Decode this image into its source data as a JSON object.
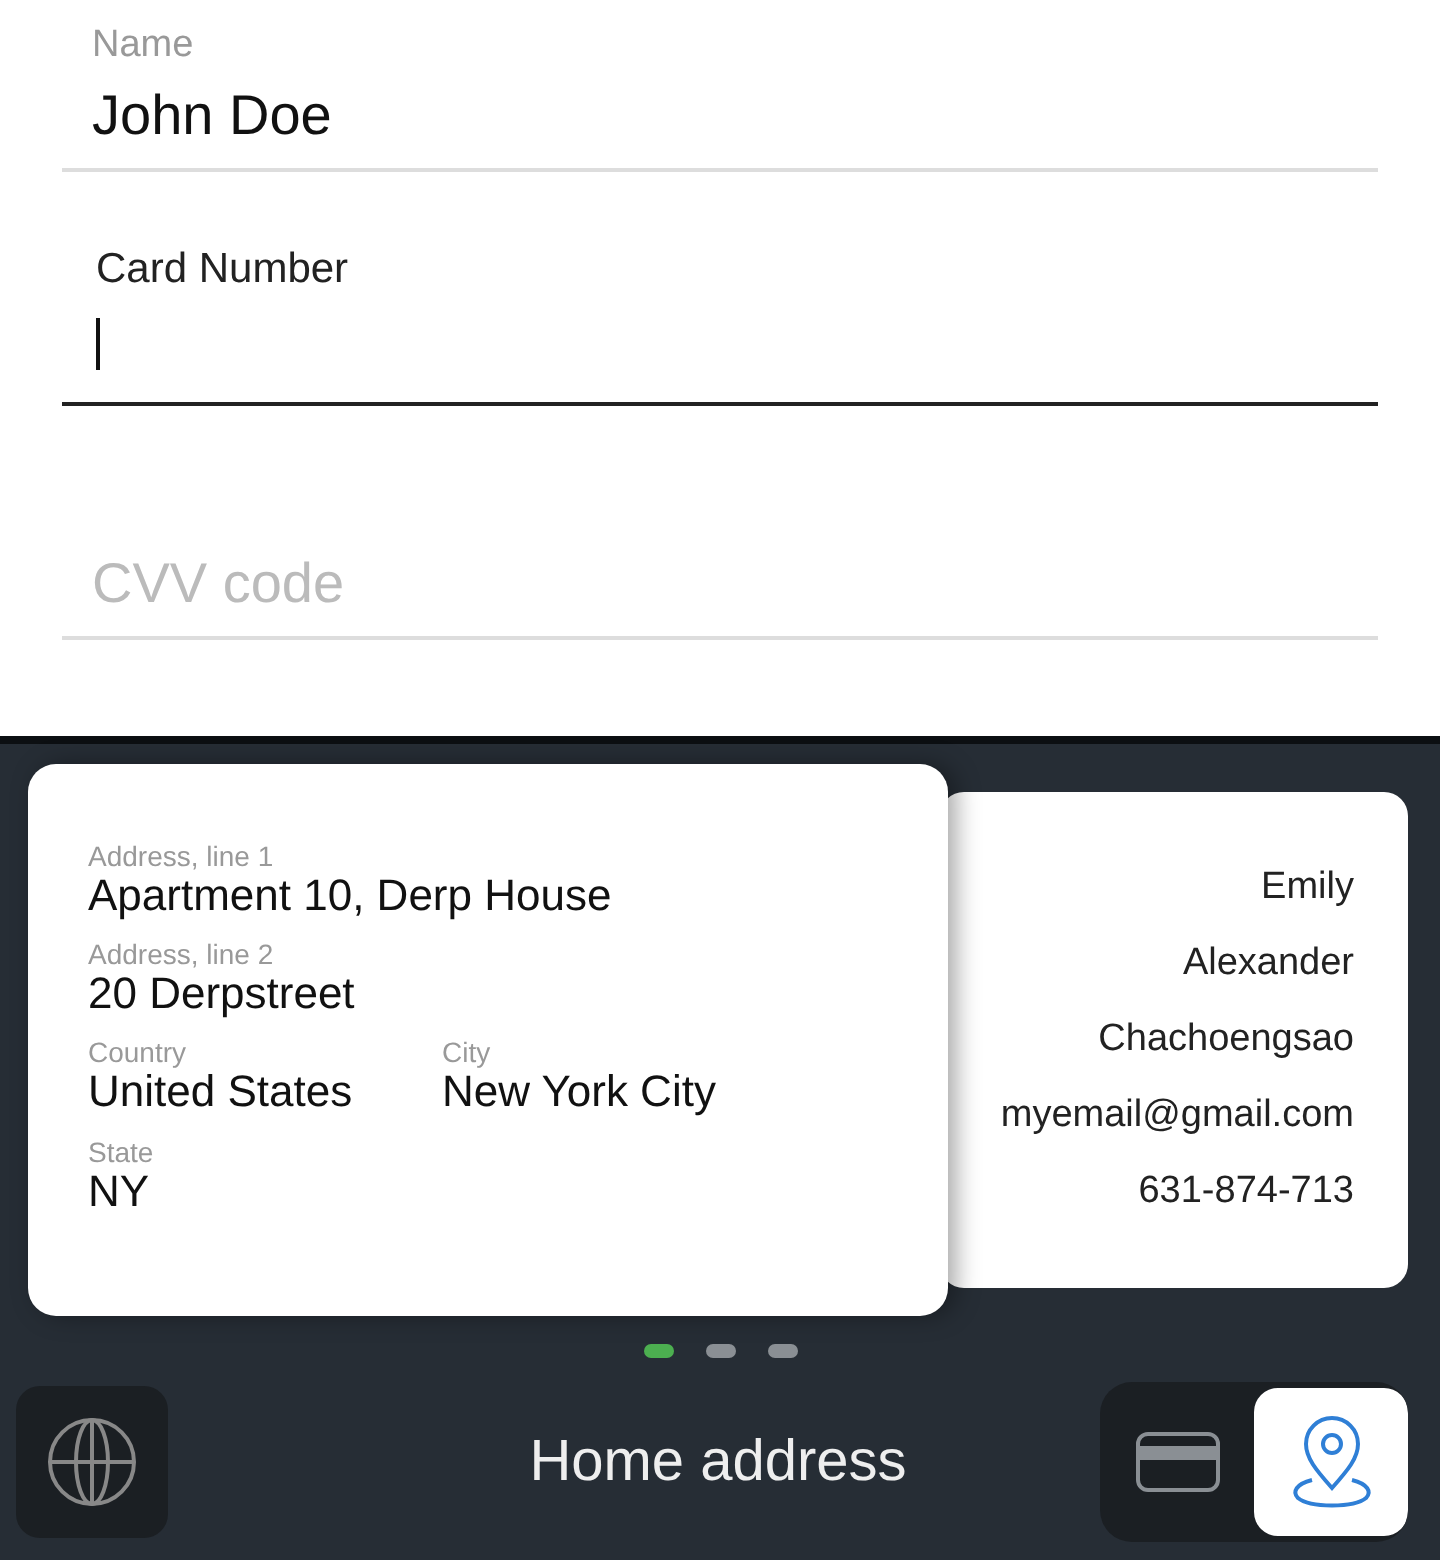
{
  "form_fields": [
    {
      "label": "Name",
      "value": "John Doe",
      "focused": false
    },
    {
      "label": "Card Number",
      "focused": true
    },
    {
      "placeholder": "CVV code",
      "focused": false
    }
  ],
  "address_card": {
    "rows": [
      [
        {
          "label": "Address, line 1",
          "value": "Apartment 10, Derp House"
        }
      ],
      [
        {
          "label": "Address, line 2",
          "value": "20 Derpstreet"
        }
      ],
      [
        {
          "label": "Country",
          "value": "United States"
        },
        {
          "label": "City",
          "value": "New York City"
        }
      ],
      [
        {
          "label": "State",
          "value": "NY"
        }
      ]
    ]
  },
  "contact_card": {
    "lines": [
      "Emily",
      "Alexander",
      "Chachoengsao",
      "myemail@gmail.com",
      "631-874-713"
    ]
  },
  "pager": [
    {
      "selected": true
    },
    {
      "selected": false
    },
    {
      "selected": false
    }
  ],
  "bottom_bar": {
    "title": "Home address",
    "segments": [
      {
        "kind": "card",
        "selected": false
      },
      {
        "kind": "pin",
        "selected": true
      }
    ]
  }
}
